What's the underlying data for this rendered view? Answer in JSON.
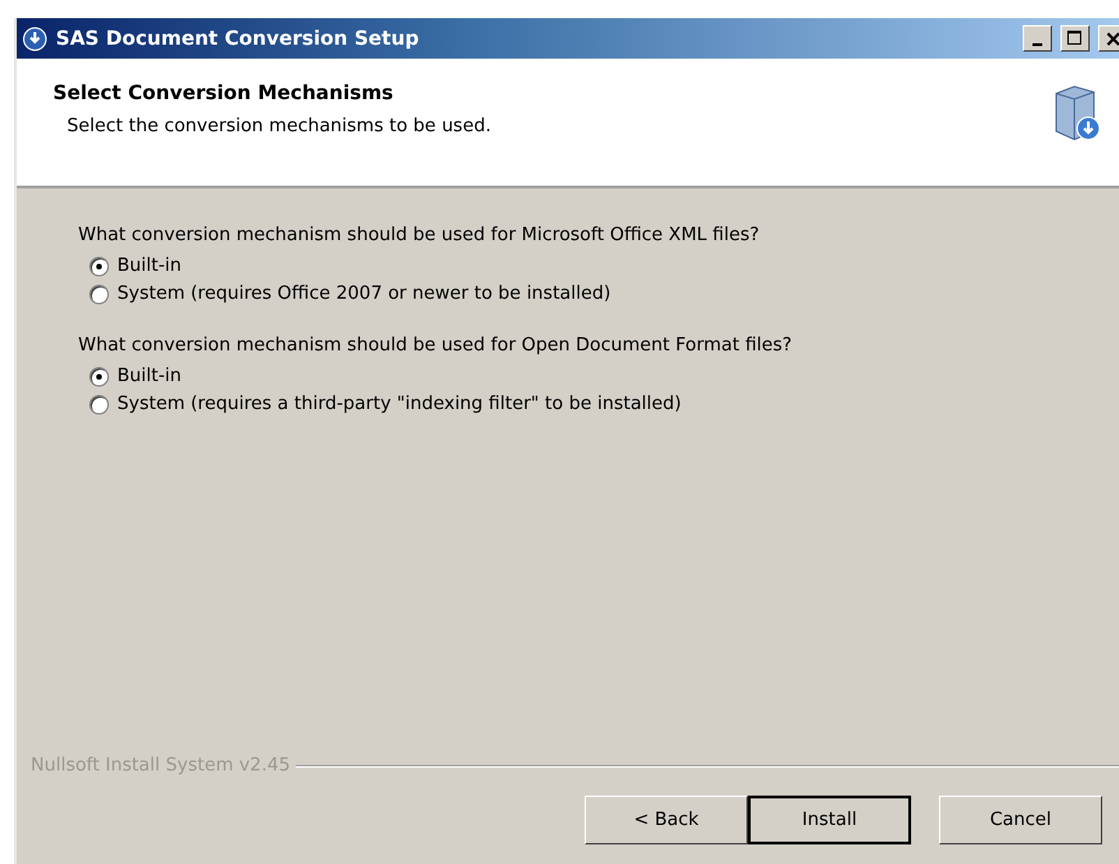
{
  "window": {
    "title": "SAS Document Conversion Setup"
  },
  "header": {
    "title": "Select Conversion Mechanisms",
    "subtitle": "Select the conversion mechanisms to be used."
  },
  "groups": [
    {
      "question": "What conversion mechanism should be used for Microsoft Office XML files?",
      "options": [
        {
          "label": "Built-in",
          "selected": true
        },
        {
          "label": "System (requires Office 2007 or newer to be installed)",
          "selected": false
        }
      ]
    },
    {
      "question": "What conversion mechanism should be used for Open Document Format files?",
      "options": [
        {
          "label": "Built-in",
          "selected": true
        },
        {
          "label": "System (requires a third-party \"indexing filter\" to be installed)",
          "selected": false
        }
      ]
    }
  ],
  "branding": "Nullsoft Install System v2.45",
  "buttons": [
    {
      "label": "< Back",
      "default": false
    },
    {
      "label": "Install",
      "default": true
    },
    {
      "label": "Cancel",
      "default": false
    }
  ]
}
